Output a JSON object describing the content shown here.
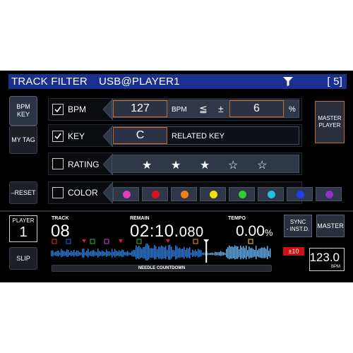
{
  "header": {
    "title": "TRACK  FILTER",
    "source": "USB@PLAYER1",
    "count": "[   5]"
  },
  "tabs": [
    {
      "label": "BPM\nKEY"
    },
    {
      "label": "MY TAG"
    }
  ],
  "reset_label": "–RESET",
  "rows": {
    "bpm": {
      "label": "BPM",
      "checked": true,
      "value": "127",
      "unit": "BPM",
      "compare": "≦",
      "plusminus": "±",
      "range": "6",
      "percent": "%"
    },
    "key": {
      "label": "KEY",
      "checked": true,
      "value": "C",
      "extra": "RELATED KEY"
    },
    "rating": {
      "label": "RATING",
      "checked": false,
      "stars": [
        "★",
        "★",
        "★",
        "☆",
        "☆"
      ]
    },
    "color": {
      "label": "COLOR",
      "checked": false,
      "colors": [
        "#e040c0",
        "#e01020",
        "#f08010",
        "#f0e010",
        "#30d030",
        "#20c0e0",
        "#2040f0",
        "#9030d0"
      ]
    }
  },
  "master_player_label": "MASTER\nPLAYER",
  "player": {
    "player_label": "PLAYER",
    "player_num": "1",
    "slip_label": "SLIP",
    "track_label": "TRACK",
    "track_num": "08",
    "remain_label": "REMAIN",
    "remain_time": "02:10.",
    "remain_ms": "080",
    "tempo_label": "TEMPO",
    "tempo_val": "0.00",
    "tempo_unit": "%",
    "sync_label": "SYNC\n- INST.D.",
    "master_label": "MASTER",
    "tempo_range": "±10",
    "bpm": "123.0",
    "bpm_unit": "BPM",
    "needle_label": "NEEDLE COUNTDOWN",
    "progress": 0.7,
    "cue_markers": [
      "A",
      "B",
      "C",
      "D",
      "E",
      "F",
      "H"
    ]
  },
  "icons": {
    "filter": "filter-funnel-icon",
    "check": "check-icon"
  }
}
